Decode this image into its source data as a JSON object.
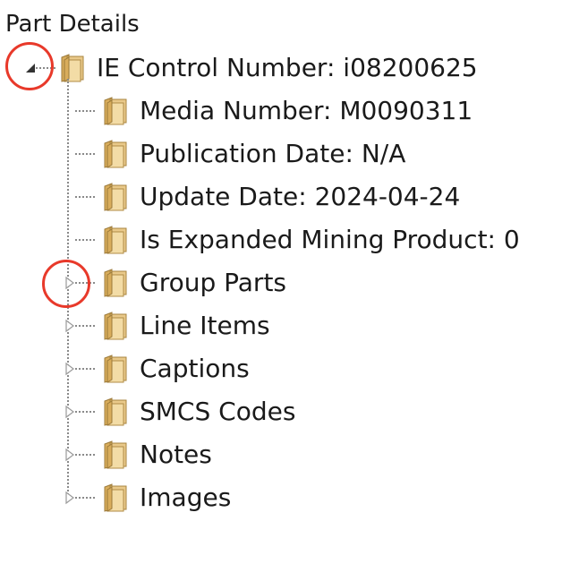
{
  "panel": {
    "title": "Part Details"
  },
  "tree": {
    "root": {
      "label": "IE Control Number: i08200625",
      "expanded": true,
      "icon": "folder-icon"
    },
    "children": [
      {
        "label": "Media Number: M0090311",
        "has_children": false,
        "icon": "folder-icon"
      },
      {
        "label": "Publication Date: N/A",
        "has_children": false,
        "icon": "folder-icon"
      },
      {
        "label": "Update Date: 2024-04-24",
        "has_children": false,
        "icon": "folder-icon"
      },
      {
        "label": "Is Expanded Mining Product: 0",
        "has_children": false,
        "icon": "folder-icon"
      },
      {
        "label": "Group Parts",
        "has_children": true,
        "expanded": false,
        "icon": "folder-icon"
      },
      {
        "label": "Line Items",
        "has_children": true,
        "expanded": false,
        "icon": "folder-icon"
      },
      {
        "label": "Captions",
        "has_children": true,
        "expanded": false,
        "icon": "folder-icon"
      },
      {
        "label": "SMCS Codes",
        "has_children": true,
        "expanded": false,
        "icon": "folder-icon"
      },
      {
        "label": "Notes",
        "has_children": true,
        "expanded": false,
        "icon": "folder-icon"
      },
      {
        "label": "Images",
        "has_children": true,
        "expanded": false,
        "icon": "folder-icon"
      }
    ]
  },
  "colors": {
    "annotation": "#e8392a",
    "folder_body": "#e9c98a",
    "folder_tab": "#d9ad5c",
    "connector": "#8a8a8a"
  }
}
